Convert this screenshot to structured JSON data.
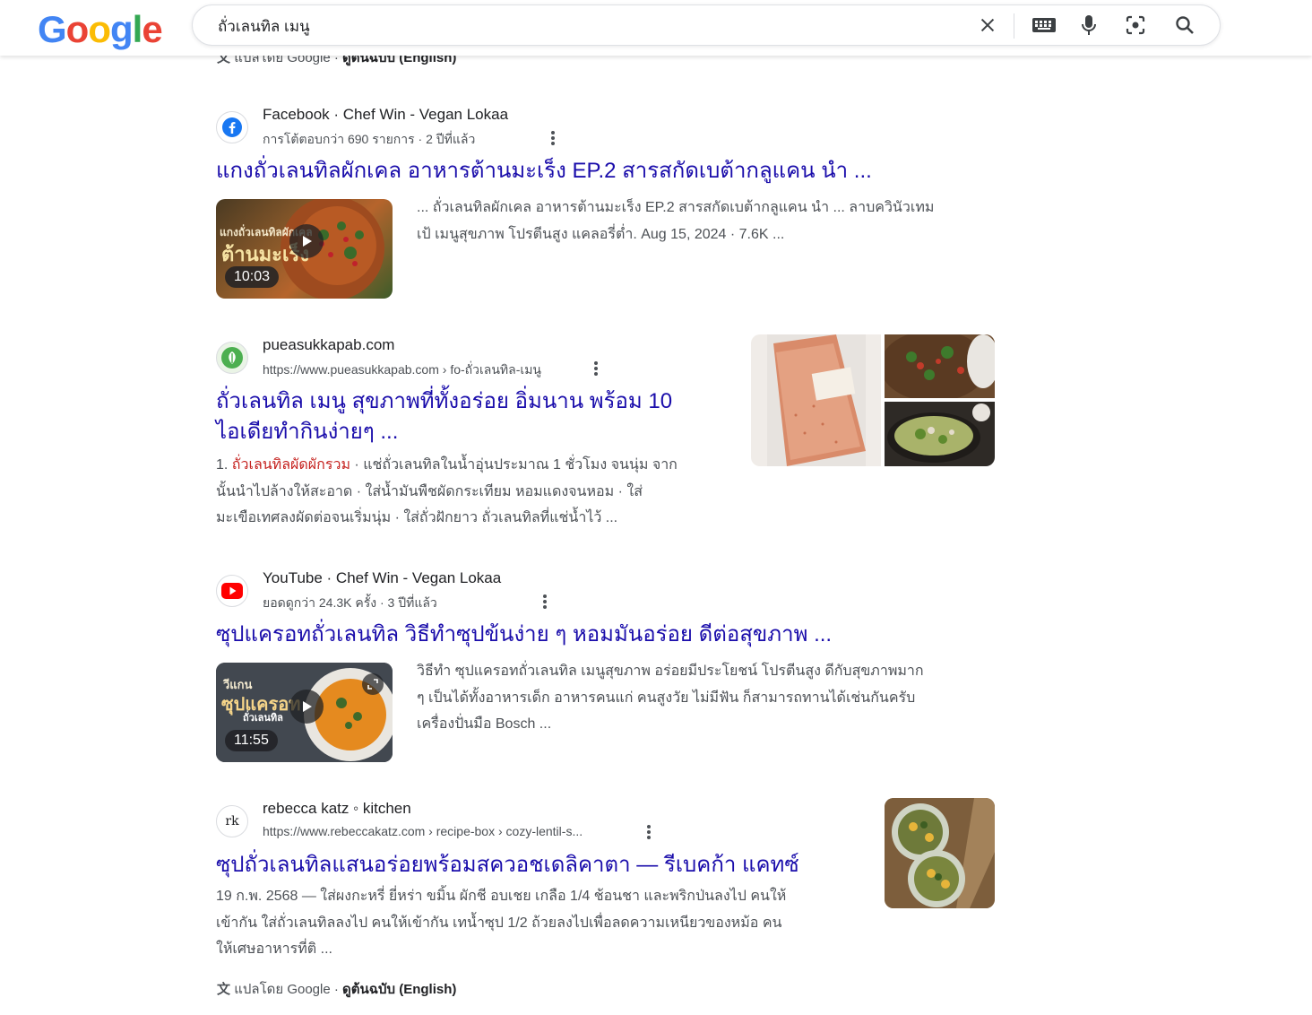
{
  "search": {
    "query": "ถั่วเลนทิล เมนู"
  },
  "logo": {
    "letters": [
      "G",
      "o",
      "o",
      "g",
      "l",
      "e"
    ]
  },
  "clipped_line": {
    "translated_by": "แปลโดย Google",
    "separator": " · ",
    "original": "ดูต้นฉบับ (English)"
  },
  "results": [
    {
      "site": "Facebook · Chef Win - Vegan Lokaa",
      "sub": "การโต้ตอบกว่า 690 รายการ · 2 ปีที่แล้ว",
      "title": "แกงถั่วเลนทิลผักเคล อาหารต้านมะเร็ง EP.2 สารสกัดเบต้ากลูแคน นำ ...",
      "snippet_lines": [
        "... ถั่วเลนทิลผักเคล อาหารต้านมะเร็ง EP.2 สารสกัดเบต้ากลูแคน นำ ... ลาบควินัวเทม",
        "เป้ เมนูสุขภาพ โปรตีนสูง แคลอรี่ต่ำ. Aug 15, 2024 · 7.6K ..."
      ],
      "duration": "10:03",
      "thumb_overlay": [
        "แกงถั่วเลนทิลผักเคล",
        "ต้านมะเร็ง"
      ]
    },
    {
      "site": "pueasukkapab.com",
      "sub": "https://www.pueasukkapab.com › fo-ถั่วเลนทิล-เมนู",
      "title_lines": [
        "ถั่วเลนทิล เมนู สุขภาพที่ทั้งอร่อย อิ่มนาน พร้อม 10",
        "ไอเดียทำกินง่ายๆ ..."
      ],
      "snippet_prefix": "1. ",
      "snippet_highlight": "ถั่วเลนทิลผัดผักรวม",
      "snippet_lines": [
        " · แช่ถั่วเลนทิลในน้ำอุ่นประมาณ 1 ชั่วโมง จนนุ่ม จาก",
        "นั้นนำไปล้างให้สะอาด · ใส่น้ำมันพืชผัดกระเทียม หอมแดงจนหอม · ใส่",
        "มะเขือเทศลงผัดต่อจนเริ่มนุ่ม · ใส่ถั่วฝักยาว ถั่วเลนทิลที่แช่น้ำไว้ ..."
      ]
    },
    {
      "site": "YouTube · Chef Win - Vegan Lokaa",
      "sub": "ยอดดูกว่า 24.3K ครั้ง · 3 ปีที่แล้ว",
      "title": "ซุปแครอทถั่วเลนทิล วิธีทำซุปข้นง่าย ๆ หอมมันอร่อย ดีต่อสุขภาพ ...",
      "snippet_lines": [
        "วิธีทำ ซุปแครอทถั่วเลนทิล เมนูสุขภาพ อร่อยมีประโยชน์ โปรตีนสูง ดีกับสุขภาพมาก",
        "ๆ เป็นได้ทั้งอาหารเด็ก อาหารคนแก่ คนสูงวัย ไม่มีฟัน ก็สามารถทานได้เช่นกันครับ",
        "เครื่องปั่นมือ Bosch ..."
      ],
      "duration": "11:55",
      "thumb_overlay": [
        "วีแกน",
        "ซุปแครอท",
        "ถั่วเลนทิล"
      ]
    },
    {
      "site": "rebecca katz ◦ kitchen",
      "sub": "https://www.rebeccakatz.com › recipe-box › cozy-lentil-s...",
      "favicon_text": "rk",
      "title": "ซุปถั่วเลนทิลแสนอร่อยพร้อมสควอชเดลิคาตา — รีเบคก้า แคทซ์",
      "snippet_lines": [
        "19 ก.พ. 2568 — ใส่ผงกะหรี่ ยี่หร่า ขมิ้น ผักชี อบเชย เกลือ 1/4 ช้อนชา และพริกป่นลงไป คนให้",
        "เข้ากัน ใส่ถั่วเลนทิลลงไป คนให้เข้ากัน เทน้ำซุป 1/2 ถ้วยลงไปเพื่อลดความเหนียวของหม้อ คน",
        "ให้เศษอาหารที่ติ ..."
      ],
      "translated_by": "แปลโดย Google",
      "separator": " · ",
      "original": "ดูต้นฉบับ (English)"
    }
  ],
  "colors": {
    "link": "#1a0dab",
    "highlight": "#c5221f",
    "google_blue": "#4285f4",
    "google_red": "#ea4335",
    "google_yellow": "#fbbc05",
    "google_green": "#34a853"
  }
}
